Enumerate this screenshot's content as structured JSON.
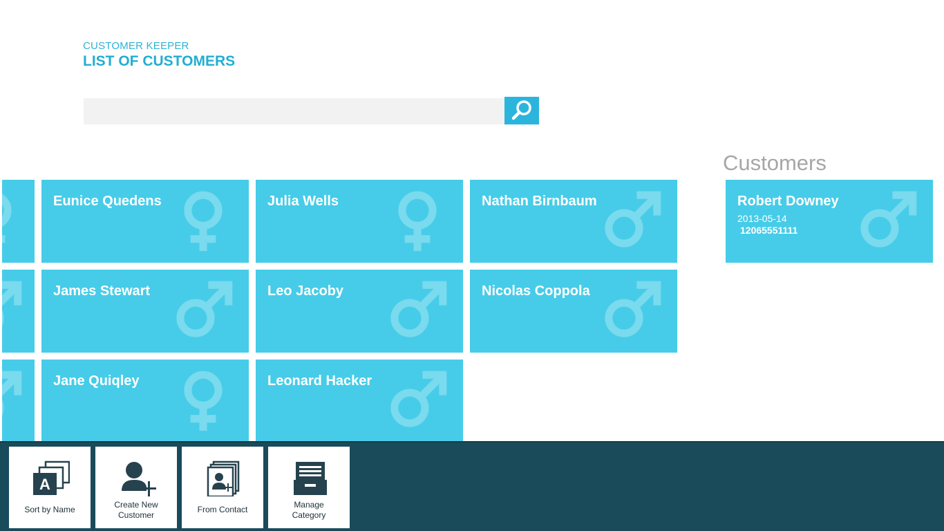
{
  "header": {
    "app_name": "CUSTOMER KEEPER",
    "page_title": "LIST OF CUSTOMERS"
  },
  "search": {
    "value": "",
    "placeholder": ""
  },
  "groups": [
    {
      "label": "Customers"
    }
  ],
  "tiles": [
    {
      "name": "Eunice Quedens",
      "gender": "female"
    },
    {
      "name": "Julia Wells",
      "gender": "female"
    },
    {
      "name": "Nathan Birnbaum",
      "gender": "male"
    },
    {
      "name": "James Stewart",
      "gender": "male"
    },
    {
      "name": "Leo Jacoby",
      "gender": "male"
    },
    {
      "name": "Nicolas Coppola",
      "gender": "male"
    },
    {
      "name": "Jane Quiqley",
      "gender": "female"
    },
    {
      "name": "Leonard Hacker",
      "gender": "male"
    },
    {
      "name": "Robert Downey",
      "gender": "male",
      "date": "2013-05-14",
      "phone": "12065551111"
    }
  ],
  "partial_tiles": [
    {
      "gender": "female"
    },
    {
      "gender": "male"
    },
    {
      "gender": "male"
    }
  ],
  "appbar": {
    "buttons": [
      {
        "label": "Sort by Name",
        "icon": "sort-by-name-icon"
      },
      {
        "label": "Create New\nCustomer",
        "icon": "create-customer-icon"
      },
      {
        "label": "From Contact",
        "icon": "from-contact-icon"
      },
      {
        "label": "Manage\nCategory",
        "icon": "manage-category-icon"
      }
    ]
  },
  "colors": {
    "accent": "#2cb5dc",
    "tile": "#46cce8",
    "appbar": "#194b5b",
    "group_header": "#a6a6a6"
  }
}
